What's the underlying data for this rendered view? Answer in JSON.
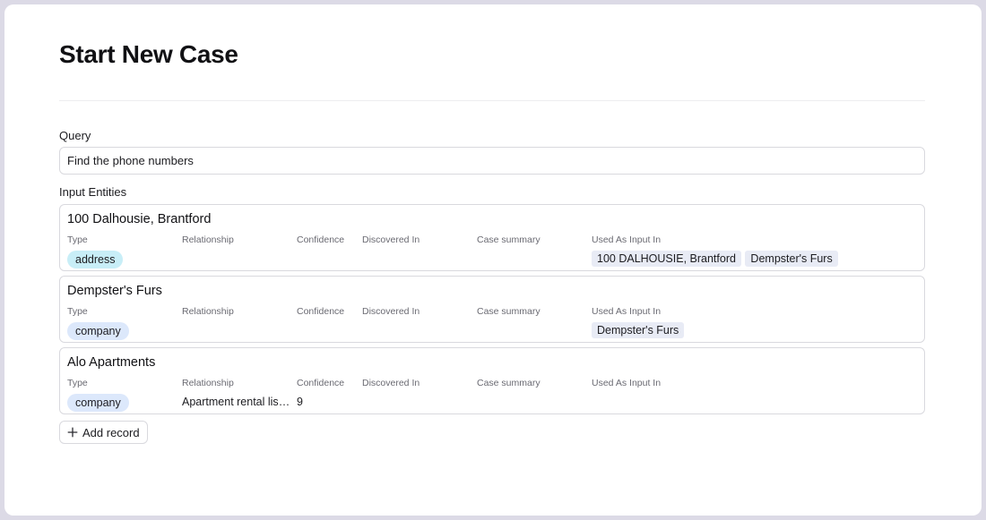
{
  "page": {
    "title": "Start New Case"
  },
  "query": {
    "label": "Query",
    "value": "Find the phone numbers"
  },
  "entities_section": {
    "label": "Input Entities"
  },
  "columns": {
    "type": "Type",
    "relationship": "Relationship",
    "confidence": "Confidence",
    "discovered_in": "Discovered In",
    "case_summary": "Case summary",
    "used_as_input_in": "Used As Input In"
  },
  "entities": [
    {
      "name": "100 Dalhousie, Brantford",
      "type": "address",
      "type_color": "#c8eef7",
      "relationship": "",
      "confidence": "",
      "discovered_in": "",
      "case_summary": "",
      "used_as_input_in": [
        "100 DALHOUSIE, Brantford",
        "Dempster's Furs"
      ]
    },
    {
      "name": "Dempster's Furs",
      "type": "company",
      "type_color": "#dce8fb",
      "relationship": "",
      "confidence": "",
      "discovered_in": "",
      "case_summary": "",
      "used_as_input_in": [
        "Dempster's Furs"
      ]
    },
    {
      "name": "Alo Apartments",
      "type": "company",
      "type_color": "#dce8fb",
      "relationship": "Apartment rental listing",
      "confidence": "9",
      "discovered_in": "",
      "case_summary": "",
      "used_as_input_in": []
    }
  ],
  "add_record": {
    "label": "Add record",
    "icon": "plus-icon"
  }
}
